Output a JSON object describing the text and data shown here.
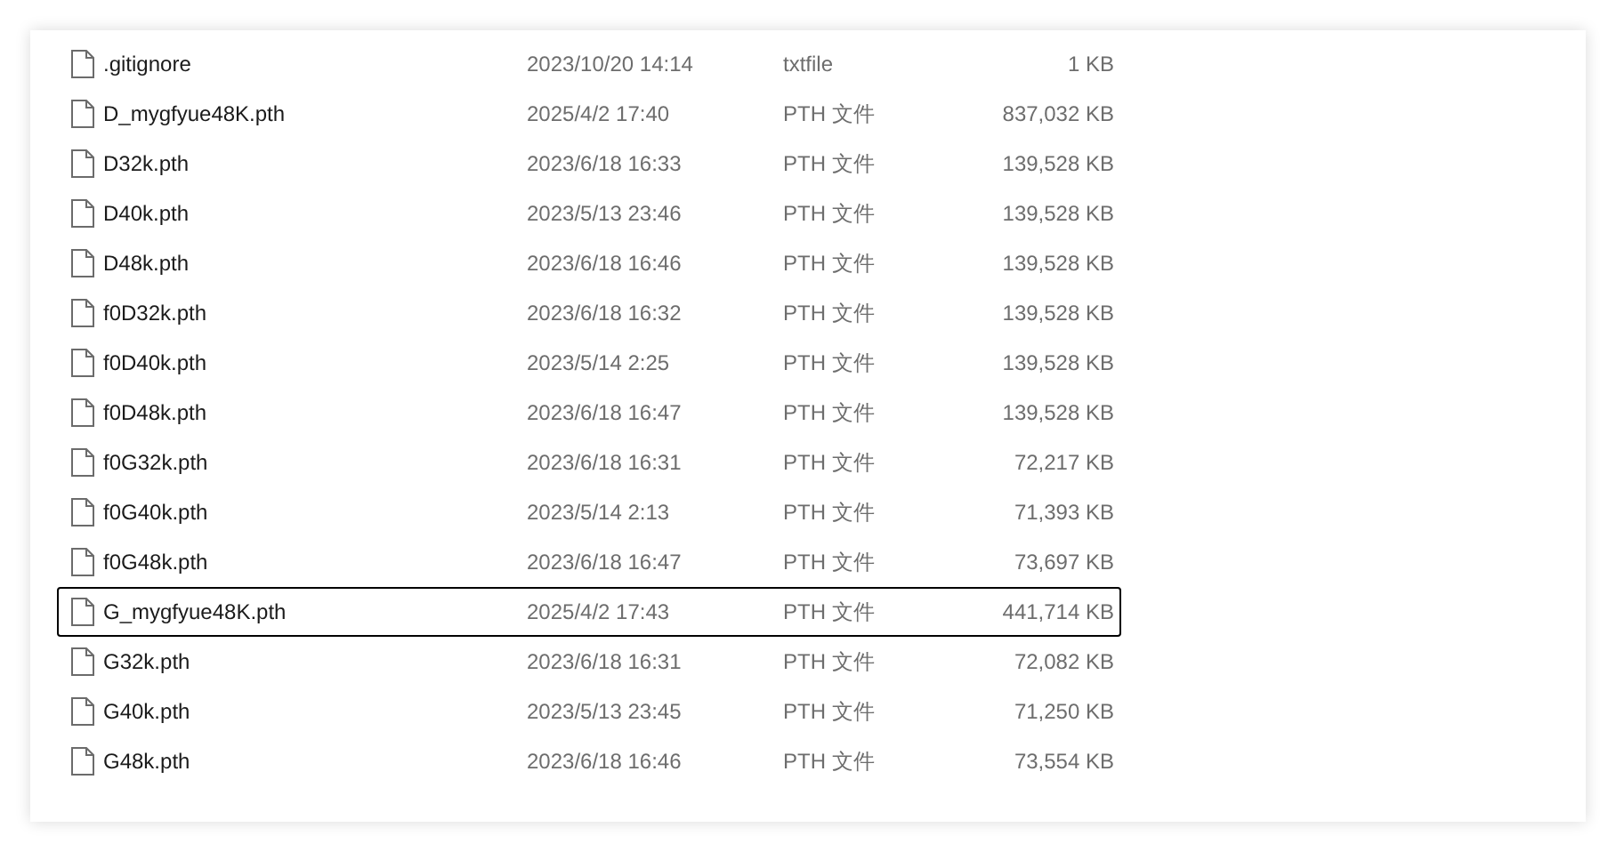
{
  "files": [
    {
      "name": ".gitignore",
      "modified": "2023/10/20 14:14",
      "type": "txtfile",
      "size": "1 KB",
      "selected": false
    },
    {
      "name": "D_mygfyue48K.pth",
      "modified": "2025/4/2 17:40",
      "type": "PTH 文件",
      "size": "837,032 KB",
      "selected": false
    },
    {
      "name": "D32k.pth",
      "modified": "2023/6/18 16:33",
      "type": "PTH 文件",
      "size": "139,528 KB",
      "selected": false
    },
    {
      "name": "D40k.pth",
      "modified": "2023/5/13 23:46",
      "type": "PTH 文件",
      "size": "139,528 KB",
      "selected": false
    },
    {
      "name": "D48k.pth",
      "modified": "2023/6/18 16:46",
      "type": "PTH 文件",
      "size": "139,528 KB",
      "selected": false
    },
    {
      "name": "f0D32k.pth",
      "modified": "2023/6/18 16:32",
      "type": "PTH 文件",
      "size": "139,528 KB",
      "selected": false
    },
    {
      "name": "f0D40k.pth",
      "modified": "2023/5/14 2:25",
      "type": "PTH 文件",
      "size": "139,528 KB",
      "selected": false
    },
    {
      "name": "f0D48k.pth",
      "modified": "2023/6/18 16:47",
      "type": "PTH 文件",
      "size": "139,528 KB",
      "selected": false
    },
    {
      "name": "f0G32k.pth",
      "modified": "2023/6/18 16:31",
      "type": "PTH 文件",
      "size": "72,217 KB",
      "selected": false
    },
    {
      "name": "f0G40k.pth",
      "modified": "2023/5/14 2:13",
      "type": "PTH 文件",
      "size": "71,393 KB",
      "selected": false
    },
    {
      "name": "f0G48k.pth",
      "modified": "2023/6/18 16:47",
      "type": "PTH 文件",
      "size": "73,697 KB",
      "selected": false
    },
    {
      "name": "G_mygfyue48K.pth",
      "modified": "2025/4/2 17:43",
      "type": "PTH 文件",
      "size": "441,714 KB",
      "selected": true
    },
    {
      "name": "G32k.pth",
      "modified": "2023/6/18 16:31",
      "type": "PTH 文件",
      "size": "72,082 KB",
      "selected": false
    },
    {
      "name": "G40k.pth",
      "modified": "2023/5/13 23:45",
      "type": "PTH 文件",
      "size": "71,250 KB",
      "selected": false
    },
    {
      "name": "G48k.pth",
      "modified": "2023/6/18 16:46",
      "type": "PTH 文件",
      "size": "73,554 KB",
      "selected": false
    }
  ]
}
